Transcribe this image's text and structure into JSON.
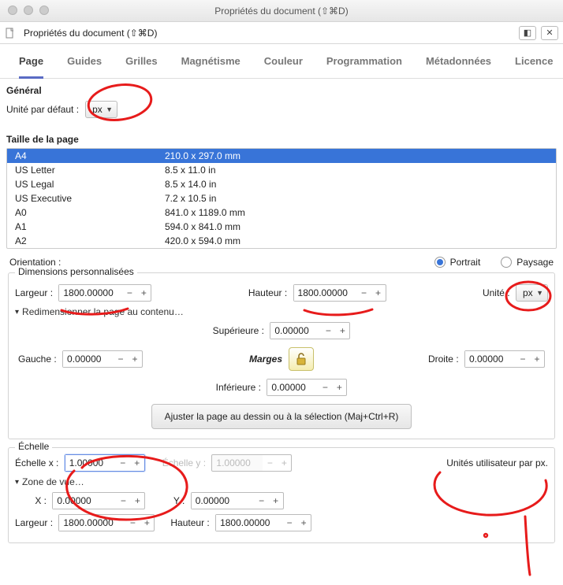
{
  "window": {
    "title": "Propriétés du document (⇧⌘D)",
    "toolbar_label": "Propriétés du document (⇧⌘D)"
  },
  "tabs": [
    "Page",
    "Guides",
    "Grilles",
    "Magnétisme",
    "Couleur",
    "Programmation",
    "Métadonnées",
    "Licence"
  ],
  "general": {
    "heading": "Général",
    "default_unit_label": "Unité par défaut :",
    "default_unit_value": "px"
  },
  "page_size": {
    "heading": "Taille de la page",
    "rows": [
      {
        "name": "A4",
        "dim": "210.0 x 297.0 mm",
        "selected": true
      },
      {
        "name": "US Letter",
        "dim": "8.5 x 11.0 in"
      },
      {
        "name": "US Legal",
        "dim": "8.5 x 14.0 in"
      },
      {
        "name": "US Executive",
        "dim": "7.2 x 10.5 in"
      },
      {
        "name": "A0",
        "dim": "841.0 x 1189.0 mm"
      },
      {
        "name": "A1",
        "dim": "594.0 x 841.0 mm"
      },
      {
        "name": "A2",
        "dim": "420.0 x 594.0 mm"
      }
    ]
  },
  "orientation": {
    "label": "Orientation :",
    "portrait": "Portrait",
    "paysage": "Paysage",
    "value": "portrait"
  },
  "custom_dims": {
    "legend": "Dimensions personnalisées",
    "width_label": "Largeur :",
    "width_value": "1800.00000",
    "height_label": "Hauteur :",
    "height_value": "1800.00000",
    "unit_label": "Unité :",
    "unit_value": "px",
    "resize_to_content": "Redimensionner la page au contenu…",
    "margins": {
      "title": "Marges",
      "top_label": "Supérieure :",
      "top": "0.00000",
      "left_label": "Gauche :",
      "left": "0.00000",
      "right_label": "Droite :",
      "right": "0.00000",
      "bottom_label": "Inférieure :",
      "bottom": "0.00000"
    },
    "fit_button": "Ajuster la page au dessin ou à la sélection (Maj+Ctrl+R)"
  },
  "scale": {
    "legend": "Échelle",
    "x_label": "Échelle x :",
    "x": "1.00000",
    "y_label": "Échelle y :",
    "y": "1.00000",
    "units_per_px": "Unités utilisateur par px.",
    "viewport": "Zone de vue…",
    "vx_label": "X :",
    "vx": "0.00000",
    "vy_label": "Y :",
    "vy": "0.00000",
    "vw_label": "Largeur :",
    "vw": "1800.00000",
    "vh_label": "Hauteur :",
    "vh": "1800.00000"
  }
}
